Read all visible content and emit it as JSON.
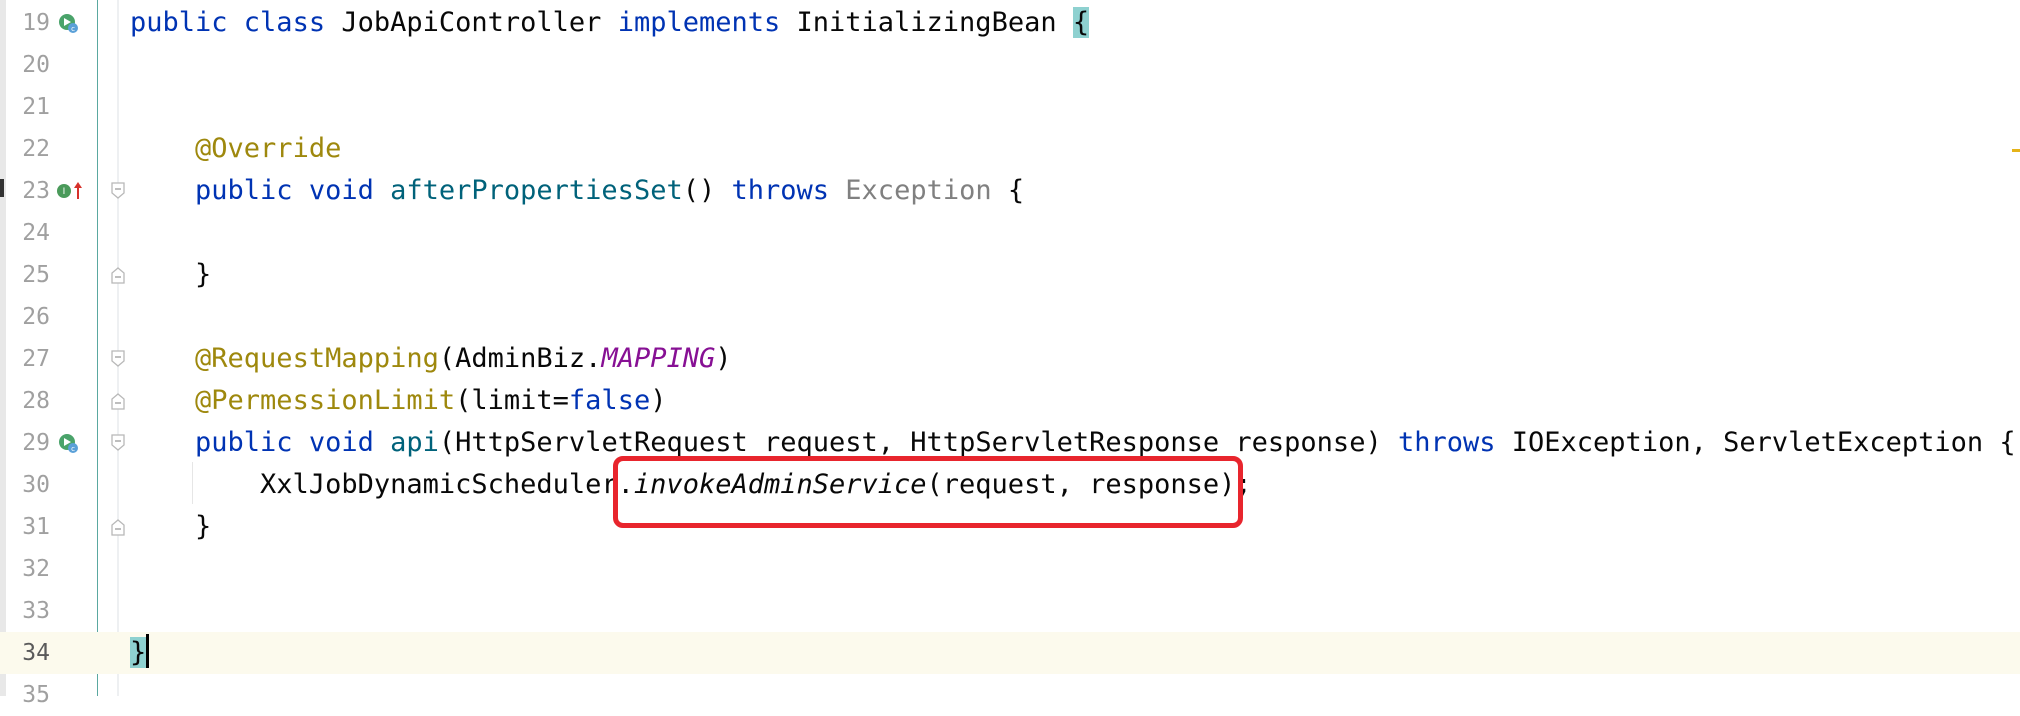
{
  "editor": {
    "lines": [
      {
        "num": "19",
        "tokens": [
          {
            "t": "public ",
            "c": "kw"
          },
          {
            "t": "class ",
            "c": "kw"
          },
          {
            "t": "JobApiController ",
            "c": ""
          },
          {
            "t": "implements ",
            "c": "kw"
          },
          {
            "t": "InitializingBean ",
            "c": ""
          },
          {
            "t": "{",
            "c": "brace-hl"
          }
        ]
      },
      {
        "num": "20",
        "tokens": []
      },
      {
        "num": "21",
        "tokens": []
      },
      {
        "num": "22",
        "tokens": [
          {
            "t": "    ",
            "c": ""
          },
          {
            "t": "@Override",
            "c": "ann"
          }
        ]
      },
      {
        "num": "23",
        "tokens": [
          {
            "t": "    ",
            "c": ""
          },
          {
            "t": "public ",
            "c": "kw"
          },
          {
            "t": "void ",
            "c": "kw"
          },
          {
            "t": "afterPropertiesSet",
            "c": "fn"
          },
          {
            "t": "() ",
            "c": ""
          },
          {
            "t": "throws ",
            "c": "kw"
          },
          {
            "t": "Exception ",
            "c": "gray"
          },
          {
            "t": "{",
            "c": ""
          }
        ]
      },
      {
        "num": "24",
        "tokens": []
      },
      {
        "num": "25",
        "tokens": [
          {
            "t": "    }",
            "c": ""
          }
        ]
      },
      {
        "num": "26",
        "tokens": []
      },
      {
        "num": "27",
        "tokens": [
          {
            "t": "    ",
            "c": ""
          },
          {
            "t": "@RequestMapping",
            "c": "ann"
          },
          {
            "t": "(AdminBiz.",
            "c": ""
          },
          {
            "t": "MAPPING",
            "c": "const"
          },
          {
            "t": ")",
            "c": ""
          }
        ]
      },
      {
        "num": "28",
        "tokens": [
          {
            "t": "    ",
            "c": ""
          },
          {
            "t": "@PermessionLimit",
            "c": "ann"
          },
          {
            "t": "(limit=",
            "c": ""
          },
          {
            "t": "false",
            "c": "kw"
          },
          {
            "t": ")",
            "c": ""
          }
        ]
      },
      {
        "num": "29",
        "tokens": [
          {
            "t": "    ",
            "c": ""
          },
          {
            "t": "public ",
            "c": "kw"
          },
          {
            "t": "void ",
            "c": "kw"
          },
          {
            "t": "api",
            "c": "fn"
          },
          {
            "t": "(HttpServletRequest request, HttpServletResponse response) ",
            "c": ""
          },
          {
            "t": "throws ",
            "c": "kw"
          },
          {
            "t": "IOException, ServletException {",
            "c": ""
          }
        ]
      },
      {
        "num": "30",
        "tokens": [
          {
            "t": "        XxlJobDynamicScheduler.",
            "c": ""
          },
          {
            "t": "invokeAdminService",
            "c": "ital"
          },
          {
            "t": "(request, response);",
            "c": ""
          }
        ]
      },
      {
        "num": "31",
        "tokens": [
          {
            "t": "    }",
            "c": ""
          }
        ]
      },
      {
        "num": "32",
        "tokens": []
      },
      {
        "num": "33",
        "tokens": []
      },
      {
        "num": "34",
        "tokens": [
          {
            "t": "}",
            "c": "brace-hl"
          }
        ],
        "current": true,
        "caret": true
      },
      {
        "num": "35",
        "tokens": []
      }
    ]
  }
}
